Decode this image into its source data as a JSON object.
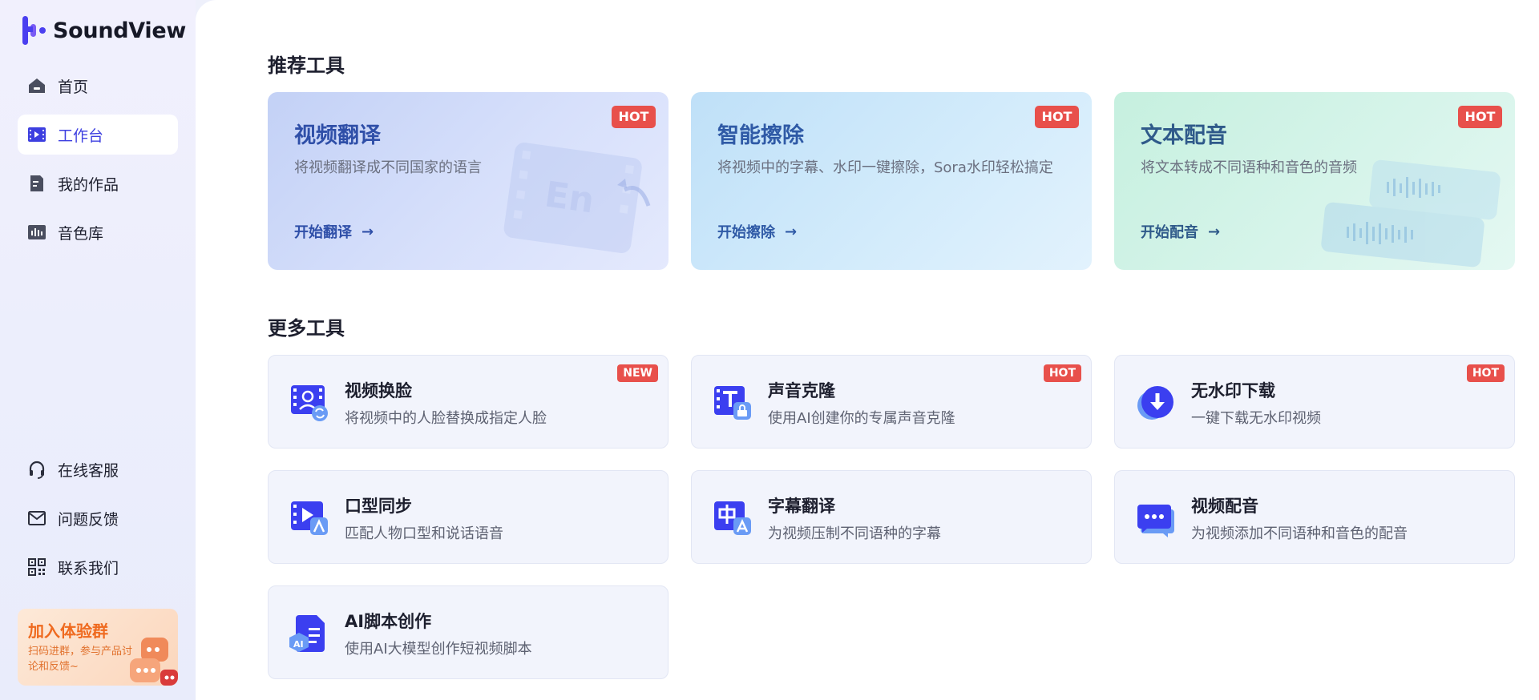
{
  "app": {
    "name": "SoundView"
  },
  "sidebar": {
    "items": [
      {
        "label": "首页",
        "icon": "home-icon"
      },
      {
        "label": "工作台",
        "icon": "workbench-icon",
        "active": true
      },
      {
        "label": "我的作品",
        "icon": "works-icon"
      },
      {
        "label": "音色库",
        "icon": "voice-library-icon"
      }
    ],
    "bottom_items": [
      {
        "label": "在线客服",
        "icon": "headset-icon"
      },
      {
        "label": "问题反馈",
        "icon": "mail-icon"
      },
      {
        "label": "联系我们",
        "icon": "qr-code-icon"
      }
    ],
    "promo": {
      "title": "加入体验群",
      "subtitle": "扫码进群，参与产品讨论和反馈~"
    }
  },
  "recommended": {
    "section_title": "推荐工具",
    "cards": [
      {
        "title": "视频翻译",
        "desc": "将视频翻译成不同国家的语言",
        "cta": "开始翻译",
        "badge": "HOT",
        "color": "#2f4fa8"
      },
      {
        "title": "智能擦除",
        "desc": "将视频中的字幕、水印一键擦除，Sora水印轻松搞定",
        "cta": "开始擦除",
        "badge": "HOT",
        "color": "#2f5aa6"
      },
      {
        "title": "文本配音",
        "desc": "将文本转成不同语种和音色的音频",
        "cta": "开始配音",
        "badge": "HOT",
        "color": "#2f5a8a"
      }
    ]
  },
  "more": {
    "section_title": "更多工具",
    "tools": [
      {
        "name": "视频换脸",
        "desc": "将视频中的人脸替换成指定人脸",
        "badge": "NEW",
        "icon": "face-swap-icon"
      },
      {
        "name": "声音克隆",
        "desc": "使用AI创建你的专属声音克隆",
        "badge": "HOT",
        "icon": "voice-clone-icon"
      },
      {
        "name": "无水印下载",
        "desc": "一键下载无水印视频",
        "badge": "HOT",
        "icon": "download-icon"
      },
      {
        "name": "口型同步",
        "desc": "匹配人物口型和说话语音",
        "badge": "",
        "icon": "lip-sync-icon"
      },
      {
        "name": "字幕翻译",
        "desc": "为视频压制不同语种的字幕",
        "badge": "",
        "icon": "subtitle-translate-icon"
      },
      {
        "name": "视频配音",
        "desc": "为视频添加不同语种和音色的配音",
        "badge": "",
        "icon": "video-dubbing-icon"
      },
      {
        "name": "AI脚本创作",
        "desc": "使用AI大模型创作短视频脚本",
        "badge": "",
        "icon": "ai-script-icon"
      }
    ]
  },
  "colors": {
    "accent": "#3d3fe0",
    "hot": "#e8504b",
    "icon": "#3b3ff0"
  }
}
